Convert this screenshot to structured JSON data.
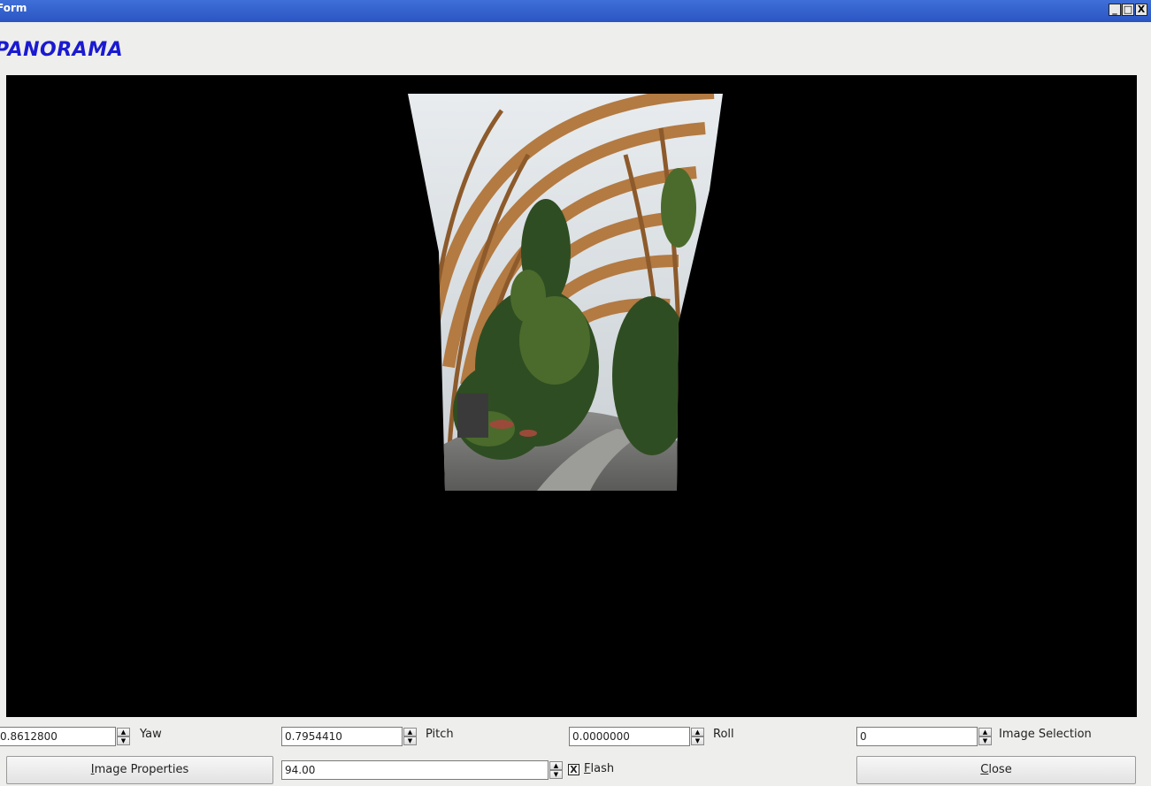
{
  "window": {
    "title": "Form",
    "controls": {
      "minimize": "_",
      "restore": "□",
      "close": "X"
    }
  },
  "app_title": "PANORAMA",
  "controls": {
    "yaw": {
      "value": "0.8612800",
      "label": "Yaw"
    },
    "pitch": {
      "value": "0.7954410",
      "label": "Pitch"
    },
    "roll": {
      "value": "0.0000000",
      "label": "Roll"
    },
    "image_selection": {
      "value": "0",
      "label": "Image Selection"
    },
    "field_of_view": {
      "value": "94.00"
    },
    "flash": {
      "label_mnemonic": "F",
      "label_rest": "lash",
      "checked": true,
      "check_glyph": "X"
    }
  },
  "buttons": {
    "image_properties": {
      "mnemonic": "I",
      "rest": "mage Properties"
    },
    "close": {
      "mnemonic": "C",
      "rest": "lose"
    }
  },
  "spin_glyphs": {
    "up": "▲",
    "down": "▼"
  },
  "viewport": {
    "content": "panorama-preview-image",
    "colors": {
      "background": "#000000",
      "wood": "#b07a45",
      "glass": "#dfe4e8",
      "foliage": "#2e4a22",
      "floor": "#6e6e6e"
    }
  }
}
